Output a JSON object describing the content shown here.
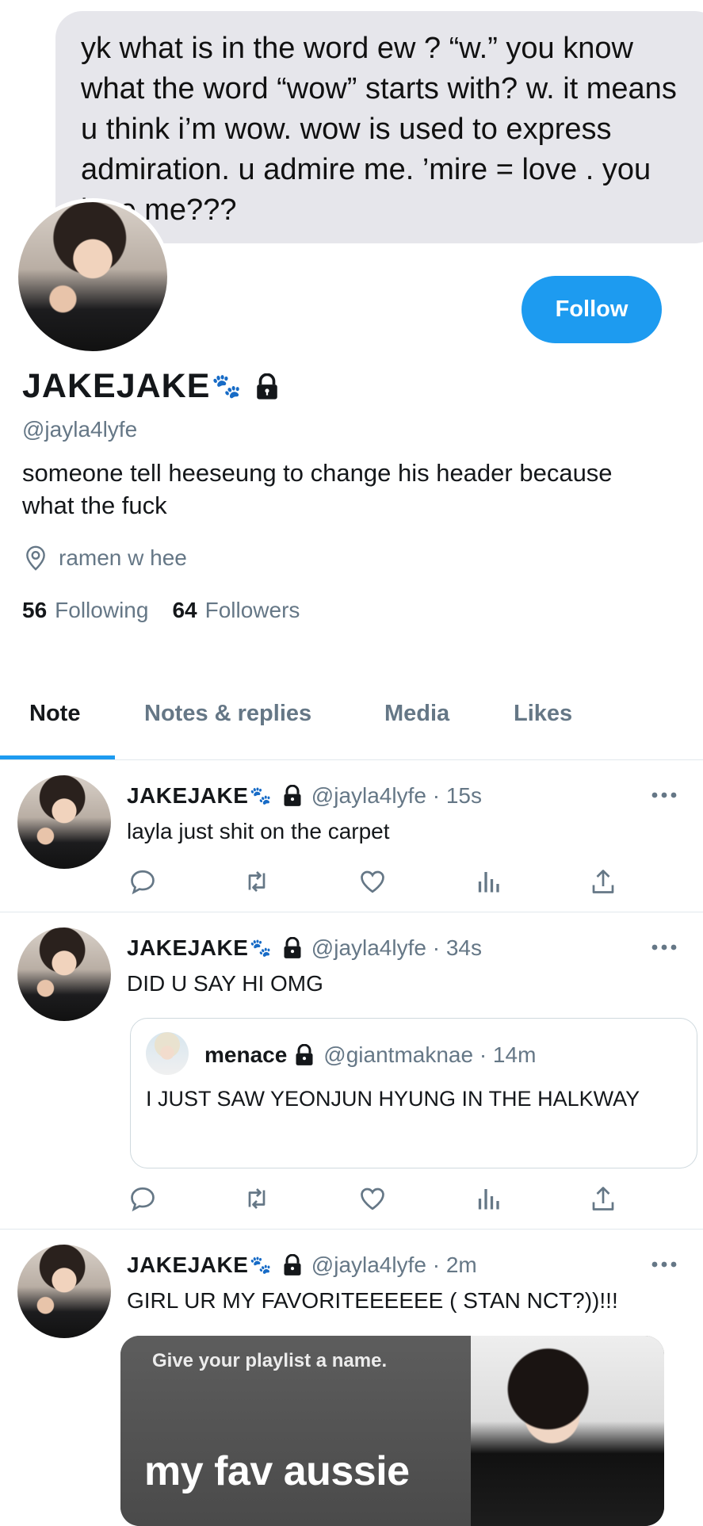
{
  "header_message": "yk what is in the word ew ? “w.” you know what the word “wow” starts with? w. it means u think i’m wow. wow is used to express admiration. u admire me. ’mire = love . you love me???",
  "profile": {
    "display_name": "JAKEJAKE",
    "name_emoji": "🐾",
    "handle": "@jayla4lyfe",
    "bio": "someone tell heeseung to change his header because what the fuck",
    "location": "ramen w hee",
    "following_count": "56",
    "following_label": "Following",
    "followers_count": "64",
    "followers_label": "Followers",
    "follow_button": "Follow"
  },
  "tabs": [
    {
      "label": "Note",
      "active": true
    },
    {
      "label": "Notes & replies",
      "active": false
    },
    {
      "label": "Media",
      "active": false
    },
    {
      "label": "Likes",
      "active": false
    }
  ],
  "tweets": [
    {
      "name": "JAKEJAKE",
      "emoji": "🐾",
      "meta": "@jayla4lyfe · 15s",
      "text": "layla just shit on the carpet"
    },
    {
      "name": "JAKEJAKE",
      "emoji": "🐾",
      "meta": "@jayla4lyfe · 34s",
      "text": "DID U SAY HI OMG",
      "quote": {
        "name": "menace",
        "meta": "@giantmaknae · 14m",
        "text": "I JUST SAW YEONJUN HYUNG IN THE HALKWAY"
      }
    },
    {
      "name": "JAKEJAKE",
      "emoji": "🐾",
      "meta": "@jayla4lyfe · 2m",
      "text": "GIRL UR MY FAVORITEEEEEE ( STAN NCT?))!!!",
      "media": {
        "prompt": "Give your playlist a name.",
        "title": "my fav aussie"
      }
    }
  ],
  "colors": {
    "accent": "#1d9bf0",
    "secondary_text": "#657786",
    "bubble": "#e6e6eb"
  },
  "icons": [
    "lock-icon",
    "location-pin-icon",
    "more-icon",
    "reply-icon",
    "retweet-icon",
    "like-icon",
    "analytics-icon",
    "share-icon"
  ]
}
